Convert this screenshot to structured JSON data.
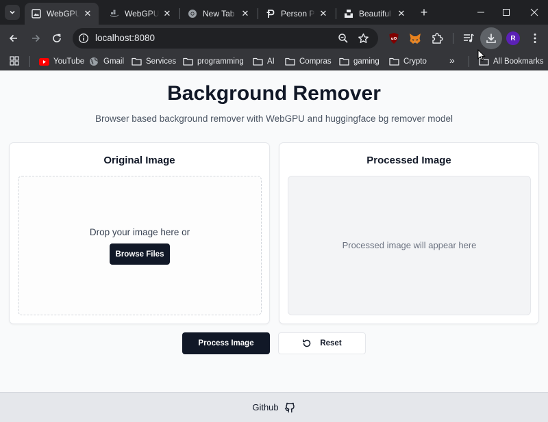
{
  "browser": {
    "tabs": [
      {
        "title": "WebGPU B",
        "favicon": "image-icon",
        "active": true
      },
      {
        "title": "WebGPU B",
        "favicon": "docker-whale-icon",
        "active": false
      },
      {
        "title": "New Tab",
        "favicon": "chrome-icon",
        "active": false
      },
      {
        "title": "Person Pho",
        "favicon": "pexels-p-icon",
        "active": false
      },
      {
        "title": "Beautiful F",
        "favicon": "unsplash-icon",
        "active": false
      }
    ],
    "address": "localhost:8080",
    "bookmarks": [
      {
        "label": "YouTube",
        "icon": "youtube-icon"
      },
      {
        "label": "Gmail",
        "icon": "globe-icon"
      },
      {
        "label": "Services",
        "icon": "folder-icon"
      },
      {
        "label": "programming",
        "icon": "folder-icon"
      },
      {
        "label": "AI",
        "icon": "folder-icon"
      },
      {
        "label": "Compras",
        "icon": "folder-icon"
      },
      {
        "label": "gaming",
        "icon": "folder-icon"
      },
      {
        "label": "Crypto",
        "icon": "folder-icon"
      }
    ],
    "all_bookmarks_label": "All Bookmarks",
    "more_bookmarks": "»",
    "profile_initial": "R",
    "extensions": [
      "ublock-origin-icon",
      "metamask-fox-icon",
      "puzzle-extensions-icon"
    ]
  },
  "app": {
    "title": "Background Remover",
    "subtitle": "Browser based background remover with WebGPU and huggingface bg remover model",
    "original_card": {
      "title": "Original Image",
      "drop_text": "Drop your image here or",
      "browse_label": "Browse Files"
    },
    "processed_card": {
      "title": "Processed Image",
      "placeholder": "Processed image will appear here"
    },
    "process_button": "Process Image",
    "reset_button": "Reset",
    "footer_link": "Github"
  },
  "colors": {
    "primary": "#111827",
    "page_bg": "#f9fafb",
    "footer_bg": "#e5e7eb",
    "chrome_dark": "#202124",
    "chrome_toolbar": "#35363a"
  }
}
